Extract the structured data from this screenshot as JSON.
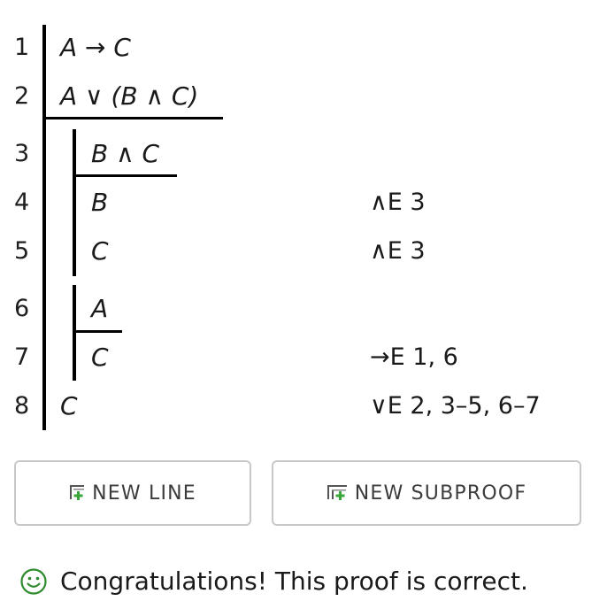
{
  "proof": {
    "lines": [
      {
        "number": "1",
        "formula": "A → C",
        "justification": ""
      },
      {
        "number": "2",
        "formula": "A ∨ (B ∧ C)",
        "justification": ""
      },
      {
        "number": "3",
        "formula": "B ∧ C",
        "justification": ""
      },
      {
        "number": "4",
        "formula": "B",
        "justification": "∧E 3"
      },
      {
        "number": "5",
        "formula": "C",
        "justification": "∧E 3"
      },
      {
        "number": "6",
        "formula": "A",
        "justification": ""
      },
      {
        "number": "7",
        "formula": "C",
        "justification": "→E 1, 6"
      },
      {
        "number": "8",
        "formula": "C",
        "justification": "∨E 2, 3–5, 6–7"
      }
    ]
  },
  "actions": {
    "new_line_label": "NEW LINE",
    "new_subproof_label": "NEW SUBPROOF"
  },
  "status": {
    "message": "Congratulations! This proof is correct.",
    "icon": "smiley-icon",
    "color": "#2e8b2e"
  },
  "colors": {
    "icon_green": "#3aa53a",
    "button_border": "#c8c8c8"
  }
}
